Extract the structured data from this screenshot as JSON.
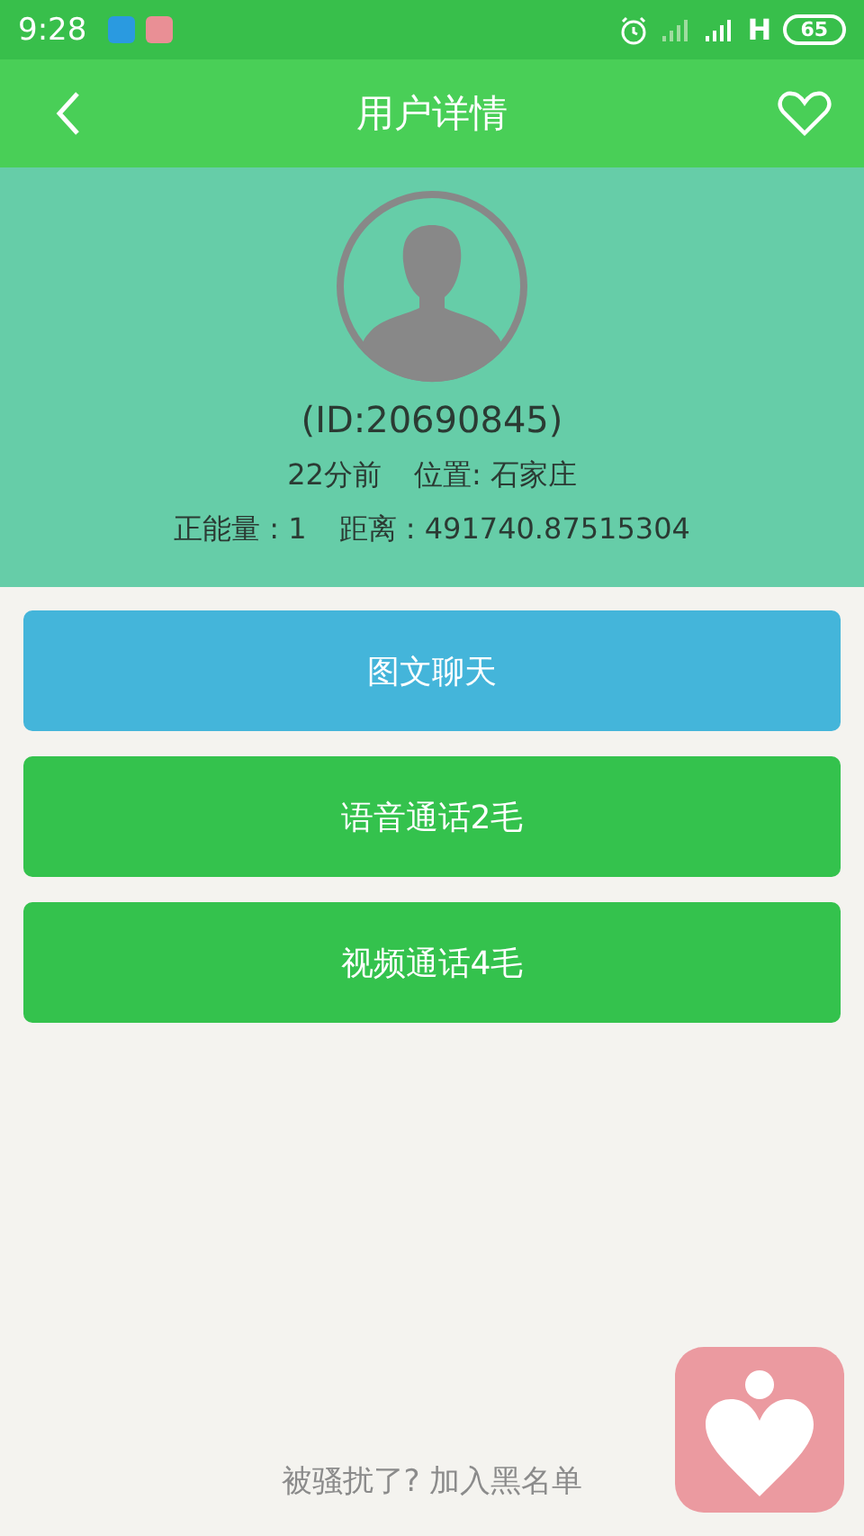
{
  "status_bar": {
    "time": "9:28",
    "network": "H",
    "battery": "65"
  },
  "header": {
    "title": "用户详情"
  },
  "profile": {
    "id": "(ID:20690845)",
    "time": "22分前",
    "location": "位置: 石家庄",
    "energy": "正能量 : 1",
    "distance": "距离 : 491740.87515304"
  },
  "buttons": [
    {
      "label": "图文聊天",
      "color": "#44b5da"
    },
    {
      "label": "语音通话2毛",
      "color": "#34c24d"
    },
    {
      "label": "视频通话4毛",
      "color": "#34c24d"
    }
  ],
  "blacklist_link": "被骚扰了? 加入黑名单"
}
